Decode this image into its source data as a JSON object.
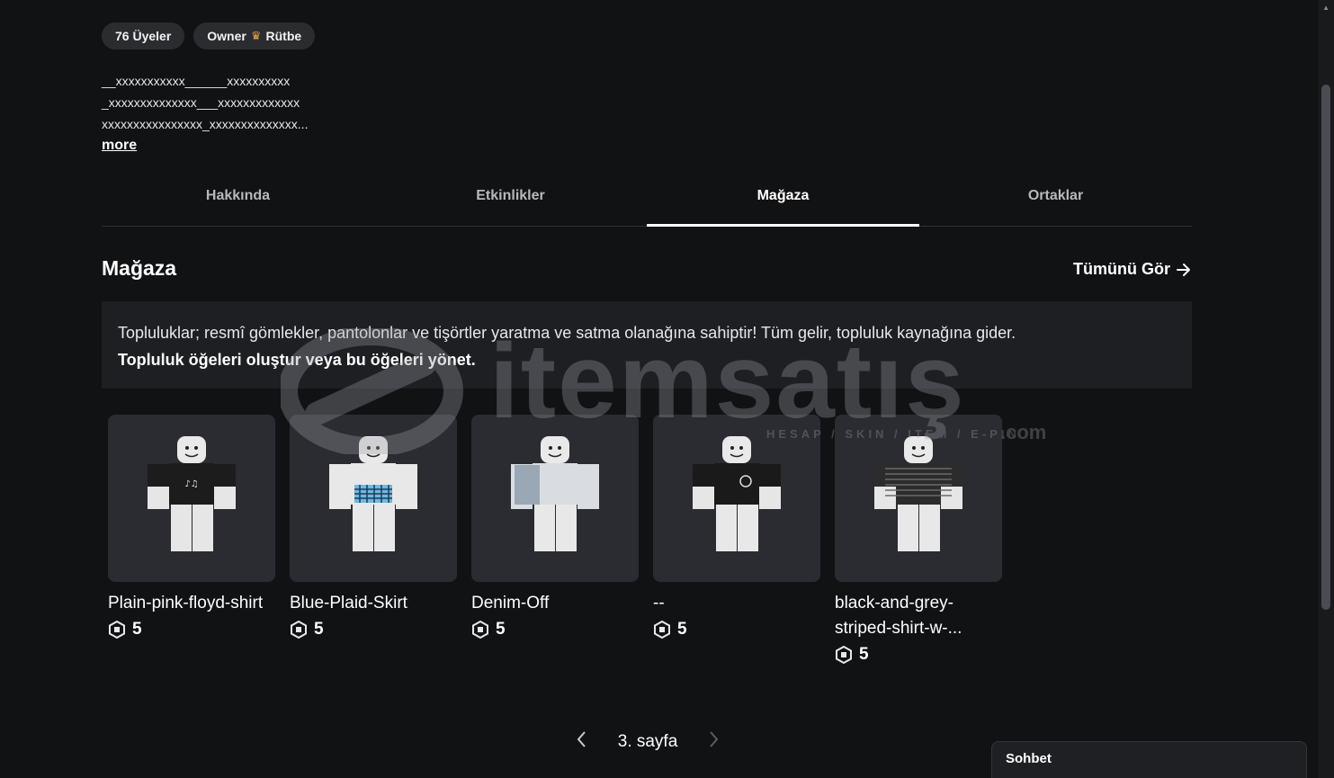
{
  "header": {
    "members_chip": "76 Üyeler",
    "role_chip_owner": "Owner",
    "role_chip_rank": "Rütbe",
    "description_lines": [
      "__xxxxxxxxxxx______xxxxxxxxxx",
      "_xxxxxxxxxxxxxx___xxxxxxxxxxxxx",
      "xxxxxxxxxxxxxxxx_xxxxxxxxxxxxxx..."
    ],
    "more_label": "more"
  },
  "tabs": [
    {
      "label": "Hakkında",
      "active": false
    },
    {
      "label": "Etkinlikler",
      "active": false
    },
    {
      "label": "Mağaza",
      "active": true
    },
    {
      "label": "Ortaklar",
      "active": false
    }
  ],
  "store": {
    "title": "Mağaza",
    "see_all": "Tümünü Gör",
    "info_text": "Topluluklar; resmî gömlekler, pantolonlar ve tişörtler yaratma ve satma olanağına sahiptir! Tüm gelir, topluluk kaynağına gider.",
    "info_link": "Topluluk öğeleri oluştur veya bu öğeleri yönet.",
    "items": [
      {
        "name": "Plain-pink-floyd-shirt",
        "price": "5",
        "shirt": "#1c1c1c",
        "pants": "#e6e6e6",
        "pattern": "text-light"
      },
      {
        "name": "Blue-Plaid-Skirt",
        "price": "5",
        "shirt": "#e8e8e8",
        "pants": "#e8e8e8",
        "pattern": "plaid"
      },
      {
        "name": "Denim-Off",
        "price": "5",
        "shirt": "#d9dde2",
        "pants": "#e8e8e8",
        "pattern": "denim"
      },
      {
        "name": "--",
        "price": "5",
        "shirt": "#1a1a1a",
        "pants": "#e8e8e8",
        "pattern": "emblem"
      },
      {
        "name": "black-and-grey-striped-shirt-w-...",
        "price": "5",
        "shirt": "#2c2c2c",
        "pants": "#e8e8e8",
        "pattern": "stripes"
      }
    ]
  },
  "pager": {
    "label": "3. sayfa"
  },
  "chat": {
    "label": "Sohbet"
  },
  "watermark": {
    "brand": "itemsatış",
    "tagline": "HESAP / SKIN / ITEM / E-PIN",
    "suffix": ".com"
  }
}
